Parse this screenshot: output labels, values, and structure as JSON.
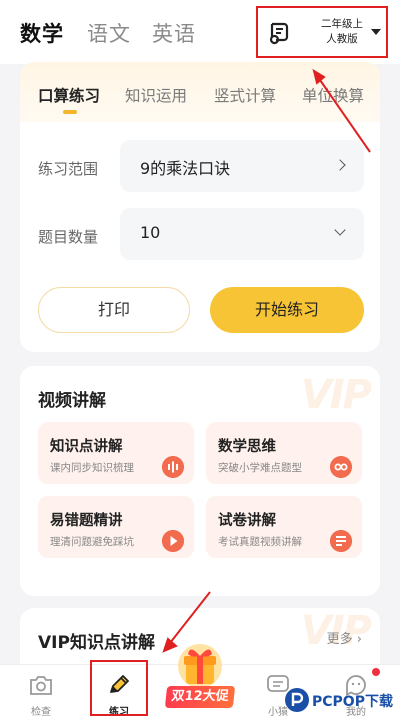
{
  "subjects": [
    {
      "label": "数学",
      "active": true
    },
    {
      "label": "语文",
      "active": false
    },
    {
      "label": "英语",
      "active": false
    }
  ],
  "grade": {
    "line1": "二年级上",
    "line2": "人教版",
    "icon": "textbook-icon"
  },
  "practice": {
    "tabs": [
      {
        "label": "口算练习",
        "active": true
      },
      {
        "label": "知识运用",
        "active": false
      },
      {
        "label": "竖式计算",
        "active": false
      },
      {
        "label": "单位换算",
        "active": false
      }
    ],
    "range_label": "练习范围",
    "range_value": "9的乘法口诀",
    "count_label": "题目数量",
    "count_value": "10",
    "print_label": "打印",
    "start_label": "开始练习"
  },
  "video": {
    "title": "视频讲解",
    "watermark": "VIP",
    "tiles": [
      {
        "title": "知识点讲解",
        "subtitle": "课内同步知识梳理",
        "icon": "sound-wave-icon"
      },
      {
        "title": "数学思维",
        "subtitle": "突破小学难点题型",
        "icon": "infinity-icon"
      },
      {
        "title": "易错题精讲",
        "subtitle": "理清问题避免踩坑",
        "icon": "play-icon"
      },
      {
        "title": "试卷讲解",
        "subtitle": "考试真题视频讲解",
        "icon": "document-icon"
      }
    ]
  },
  "vip": {
    "title": "VIP知识点讲解",
    "more": "更多 ›",
    "watermark": "VIP"
  },
  "nav": {
    "items": [
      {
        "label": "检查",
        "icon": "camera-icon"
      },
      {
        "label": "练习",
        "icon": "pencil-icon",
        "active": true
      },
      {
        "label": "小猿",
        "icon": "chat-icon"
      },
      {
        "label": "我的",
        "icon": "face-icon"
      }
    ],
    "promo": "双12大促"
  },
  "watermark": "PCPOP下载",
  "colors": {
    "accent": "#f7c435",
    "annotation": "#e02020",
    "tile_bg": "#fff2ee"
  }
}
